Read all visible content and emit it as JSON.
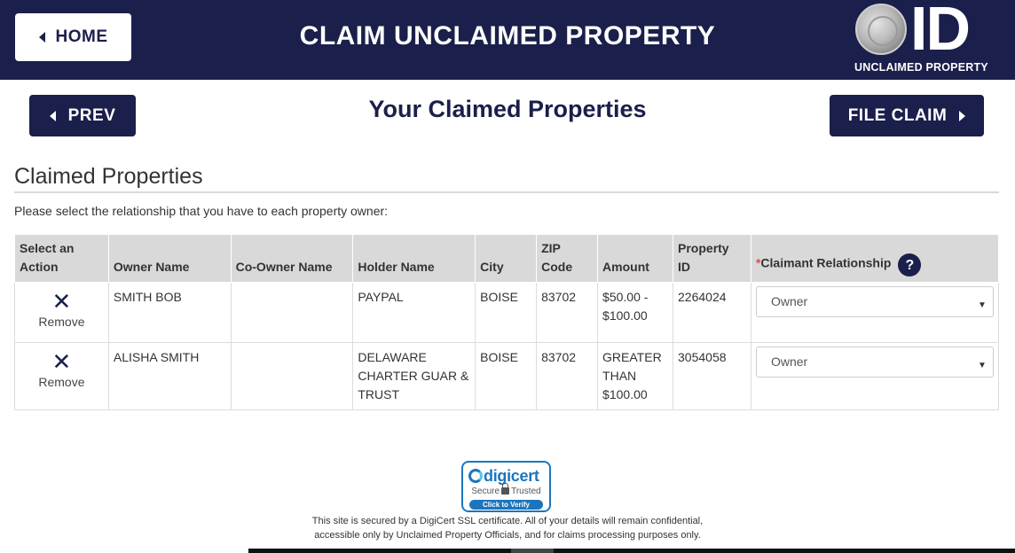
{
  "header": {
    "home_label": "HOME",
    "title": "CLAIM UNCLAIMED PROPERTY",
    "logo_text": "ID",
    "logo_subtitle": "UNCLAIMED PROPERTY"
  },
  "nav": {
    "prev_label": "PREV",
    "page_title": "Your Claimed Properties",
    "file_claim_label": "FILE CLAIM"
  },
  "section": {
    "heading": "Claimed Properties",
    "instructions": "Please select the relationship that you have to each property owner:"
  },
  "table": {
    "headers": {
      "action_line1": "Select an",
      "action_line2": "Action",
      "owner": "Owner Name",
      "coowner": "Co-Owner Name",
      "holder": "Holder Name",
      "city": "City",
      "zip_line1": "ZIP",
      "zip_line2": "Code",
      "amount": "Amount",
      "propid_line1": "Property",
      "propid_line2": "ID",
      "relationship_required_mark": "*",
      "relationship": "Claimant Relationship",
      "help": "?"
    },
    "remove_glyph": "✕",
    "rows": [
      {
        "remove_label": "Remove",
        "owner": "SMITH BOB",
        "coowner": "",
        "holder_lines": [
          "PAYPAL"
        ],
        "city": "BOISE",
        "zip": "83702",
        "amount_lines": [
          "$50.00 -",
          "$100.00"
        ],
        "property_id": "2264024",
        "relationship": "Owner"
      },
      {
        "remove_label": "Remove",
        "owner": "ALISHA SMITH",
        "coowner": "",
        "holder_lines": [
          "DELAWARE",
          "CHARTER GUAR &",
          "TRUST"
        ],
        "city": "BOISE",
        "zip": "83702",
        "amount_lines": [
          "GREATER",
          "THAN",
          "$100.00"
        ],
        "property_id": "3054058",
        "relationship": "Owner"
      }
    ]
  },
  "footer": {
    "badge_brand": "digicert",
    "badge_secure": "Secure",
    "badge_trusted": "Trusted",
    "badge_verify": "Click to Verify",
    "line1": "This site is secured by a DigiCert SSL certificate. All of your details will remain confidential,",
    "line2": "accessible only by Unclaimed Property Officials, and for claims processing purposes only."
  },
  "colors": {
    "brand_navy": "#1b1f4b",
    "header_bg": "#1b1f4b",
    "table_header_bg": "#d9d9d9",
    "required_red": "#d9534f",
    "digicert_blue": "#1c75bc"
  },
  "icons": {
    "home": "caret-left-icon",
    "prev": "caret-left-icon",
    "file_claim": "caret-right-icon",
    "help": "question-circle-icon",
    "remove": "close-icon",
    "select": "chevron-down-icon",
    "lock": "lock-icon"
  }
}
